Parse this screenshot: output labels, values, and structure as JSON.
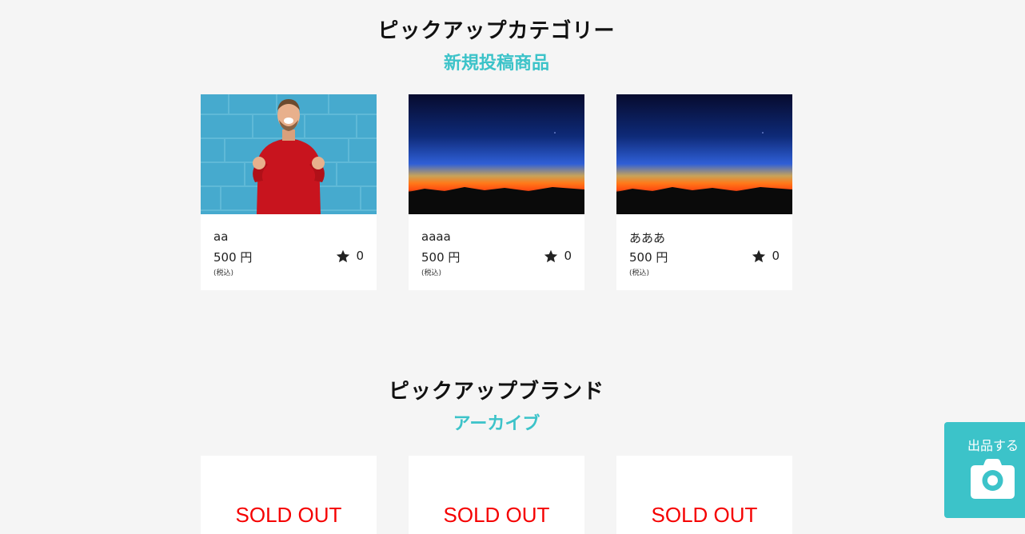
{
  "category_section": {
    "title": "ピックアップカテゴリー",
    "subtitle": "新規投稿商品"
  },
  "products": [
    {
      "name": "aa",
      "price": "500 円",
      "tax": "(税込)",
      "likes": "0",
      "image": "man-red-sweater-photo"
    },
    {
      "name": "aaaa",
      "price": "500 円",
      "tax": "(税込)",
      "likes": "0",
      "image": "sunset-horizon-photo"
    },
    {
      "name": "あああ",
      "price": "500 円",
      "tax": "(税込)",
      "likes": "0",
      "image": "sunset-horizon-photo"
    }
  ],
  "brand_section": {
    "title": "ピックアップブランド",
    "subtitle": "アーカイブ"
  },
  "sold_items": [
    {
      "label": "SOLD OUT"
    },
    {
      "label": "SOLD OUT"
    },
    {
      "label": "SOLD OUT"
    }
  ],
  "sell_button": {
    "label": "出品する",
    "icon": "camera-icon"
  },
  "colors": {
    "accent": "#3cc3c9",
    "sold_out": "#f50000",
    "background": "#f5f5f5"
  }
}
